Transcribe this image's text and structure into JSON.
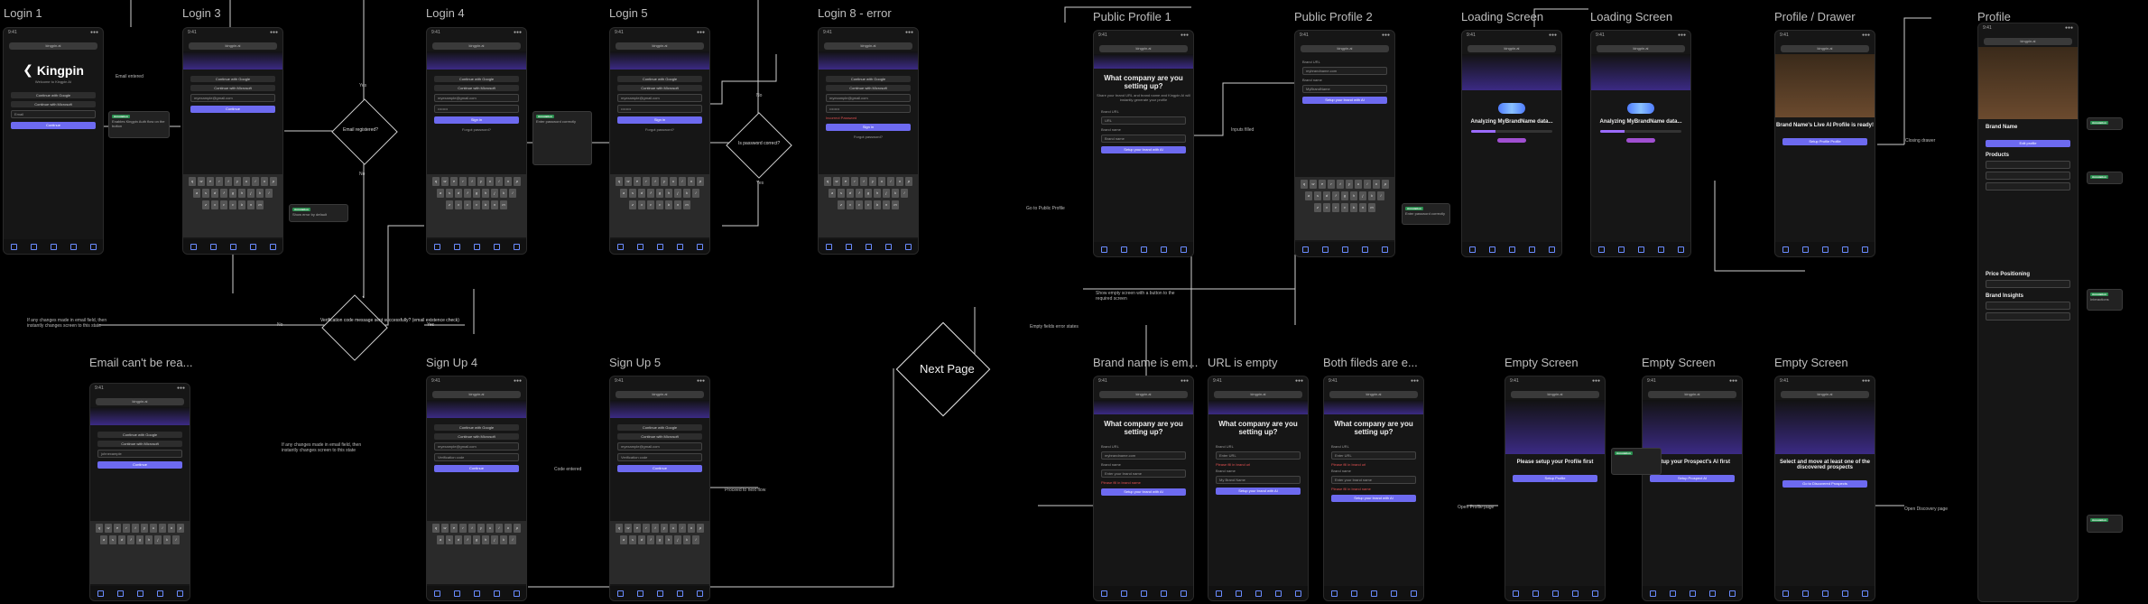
{
  "titles": {
    "login1": "Login 1",
    "login3": "Login 3",
    "login4": "Login 4",
    "login5": "Login 5",
    "login8": "Login 8 - error",
    "public1": "Public Profile 1",
    "public2": "Public Profile 2",
    "loading1": "Loading Screen",
    "loading2": "Loading Screen",
    "drawer": "Profile / Drawer",
    "profile": "Profile",
    "email_err": "Email can't be rea...",
    "signup4": "Sign Up 4",
    "signup5": "Sign Up 5",
    "brand_empty": "Brand name is em...",
    "url_empty": "URL is empty",
    "both_empty": "Both fileds are e...",
    "empty1": "Empty Screen",
    "empty2": "Empty Screen",
    "empty3": "Empty Screen"
  },
  "common": {
    "time": "9:41",
    "url": "kingpin.ai",
    "welcome": "Welcome to Kingpin AI",
    "google": "Continue with Google",
    "microsoft": "Continue with Microsoft",
    "continue": "Continue",
    "signin": "Sign in",
    "forgot": "Forgot password?",
    "brand": "Kingpin"
  },
  "flow": {
    "email_entered": "Email entered",
    "email_registered": "Email registered?",
    "yes": "Yes",
    "no": "No",
    "password_correct": "Is password correct?",
    "verification": "Verification code message sent successfully? (email existence check)",
    "next_page": "Next Page",
    "inputs_filled": "Inputs filled",
    "empty_fields": "Empty fields error states",
    "show_empty": "Show empty screen with a button to the required screen",
    "closing_drawer": "Closing drawer",
    "code_entered": "Code entered",
    "proceed": "Proceed to next flow",
    "open_profile": "Open Profile page",
    "open_discovery": "Open Discovery page",
    "go_public": "Go to Public Profile",
    "any_changes": "If any changes made in email field, then instantly changes screen to this state",
    "any_changes2": "If any changes made in email field, then instantly changes screen to this state",
    "incorrect": "Incorrect Password"
  },
  "public": {
    "question": "What company are you setting up?",
    "sub": "Share your brand URL and brand name and Kingpin AI will instantly generate your profile",
    "brand_url": "Brand URL",
    "brand_name": "Brand name",
    "cta": "Setup your brand with AI",
    "err_url": "Please fill in brand url",
    "err_name": "Please fill in brand name"
  },
  "loading": {
    "text": "Analyzing MyBrandName data...",
    "progress": 0.3
  },
  "drawer": {
    "ready": "Brand Name's Live AI Profile is ready!",
    "cta": "Setup Profile Profile"
  },
  "empty": {
    "e1": "Please setup your Profile first",
    "e1_btn": "Setup Profile",
    "e2": "Setup your Prospect's AI first",
    "e2_btn": "Setup Prospect AI",
    "e3": "Select and move at least one of the discovered prospects",
    "e3_btn": "Go to Discovered Prospects"
  },
  "profile": {
    "name": "Brand Name",
    "products": "Products",
    "price": "Price Positioning",
    "insights": "Brand Insights",
    "edit": "Edit profile"
  },
  "notes": {
    "n_login1": "Enables Kingpin Auth flow on the button",
    "n_signup": "Show error by default",
    "n_verify": "Enter password correctly",
    "n_drawer": "Save profile data",
    "n_profile": "Interactions"
  }
}
